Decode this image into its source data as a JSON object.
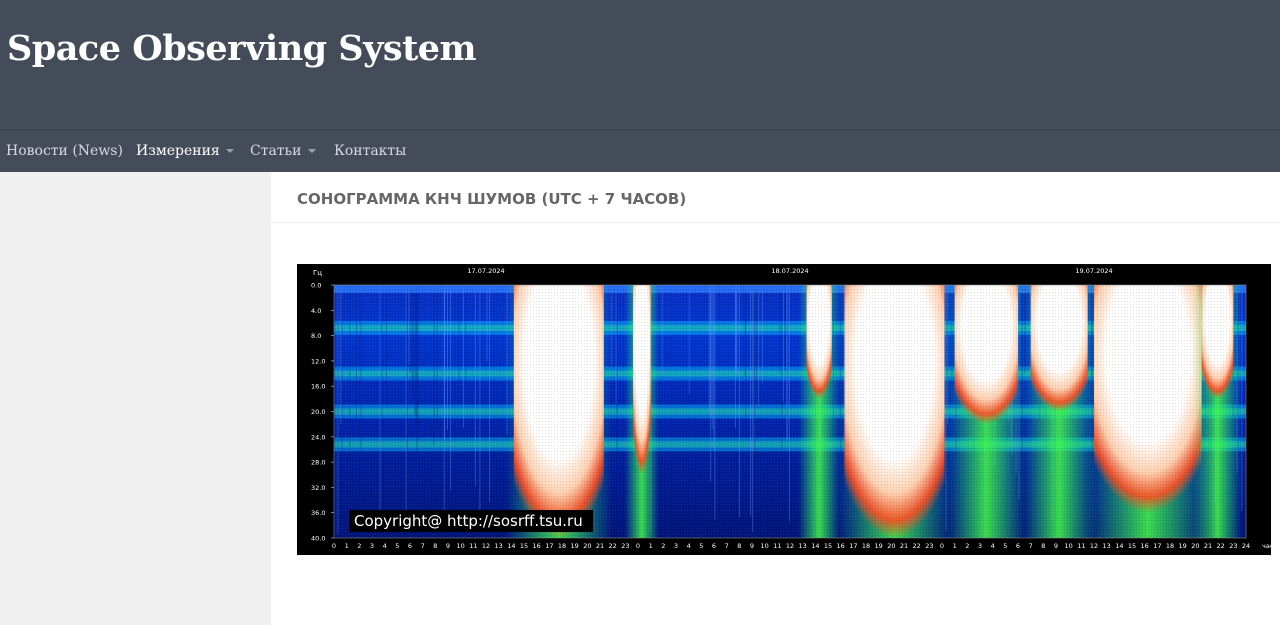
{
  "site": {
    "title": "Space Observing System"
  },
  "nav": {
    "items": [
      {
        "label": "Новости (News)",
        "dropdown": false
      },
      {
        "label": "Измерения",
        "dropdown": true,
        "active": true
      },
      {
        "label": "Статьи",
        "dropdown": true
      },
      {
        "label": "Контакты",
        "dropdown": false
      }
    ]
  },
  "page": {
    "title": "СОНОГРАММА КНЧ ШУМОВ (UTC + 7 ЧАСОВ)"
  },
  "sonogram": {
    "y_unit": "Гц",
    "y_ticks": [
      "0.0",
      "4.0",
      "8.0",
      "12.0",
      "16.0",
      "20.0",
      "24.0",
      "28.0",
      "32.0",
      "36.0",
      "40.0"
    ],
    "dates": [
      "17.07.2024",
      "18.07.2024",
      "19.07.2024"
    ],
    "x_unit": "час",
    "hours_per_day": 24,
    "copyright": "Copyright@ http://sosrff.tsu.ru",
    "colors": {
      "background": "#000000",
      "low": "#0010a0",
      "mid": "#00c8ff",
      "high": "#33ff55",
      "peak": "#ff3a12",
      "saturated": "#ffffff"
    }
  }
}
